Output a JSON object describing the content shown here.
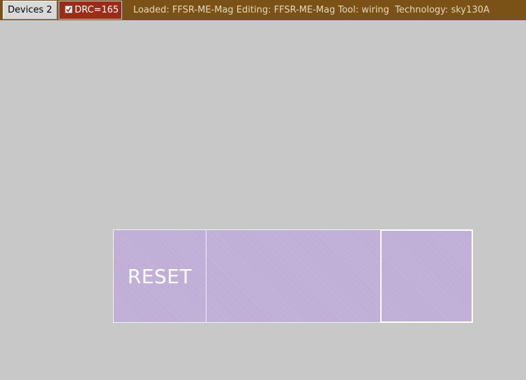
{
  "toolbar": {
    "devices_button_label": "Devices 2",
    "drc_label": "DRC=165",
    "drc_checked": true,
    "status": "Loaded: FFSR-ME-Mag Editing: FFSR-ME-Mag Tool: wiring  Technology: sky130A"
  },
  "colors": {
    "toolbar_background": "#7a5218",
    "drc_background": "#9a2c18",
    "canvas_background": "#c8c8c8",
    "cell_fill": "#c2b0d8"
  },
  "layout_view": {
    "cells": [
      {
        "label": "RESET"
      },
      {
        "label": ""
      },
      {
        "label": ""
      }
    ]
  }
}
